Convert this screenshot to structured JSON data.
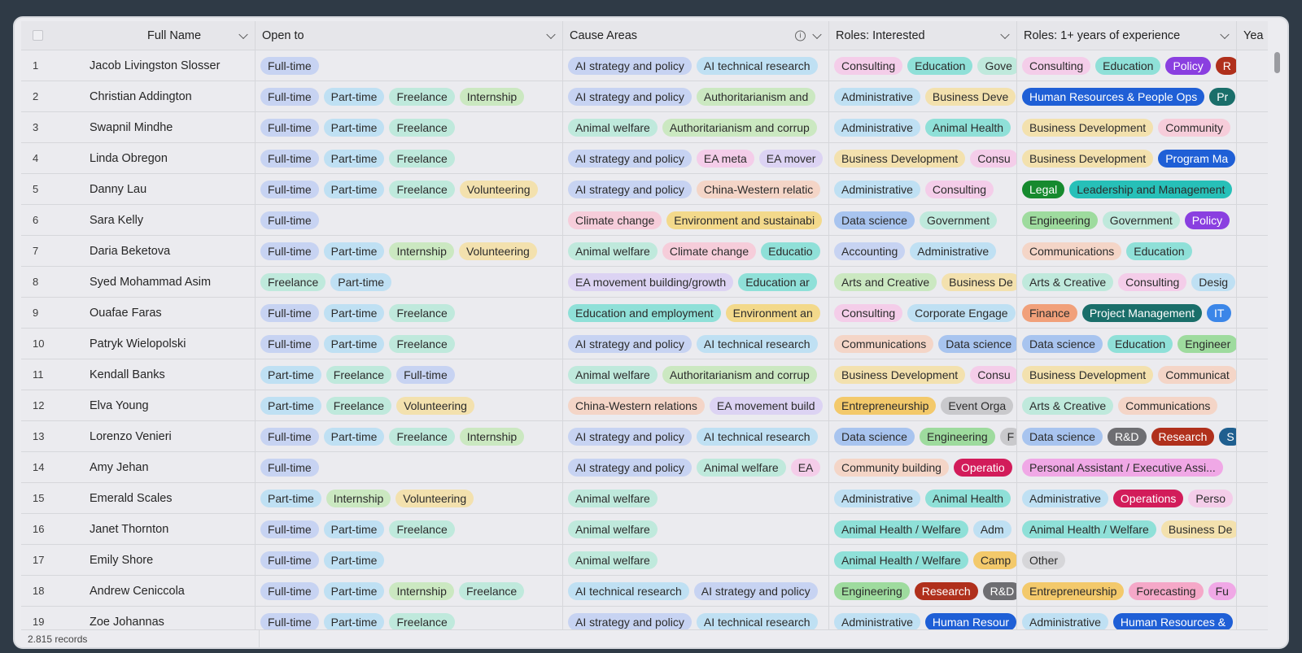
{
  "header": {
    "full_name": "Full Name",
    "open_to": "Open to",
    "cause_areas": "Cause Areas",
    "roles_interested": "Roles: Interested",
    "roles_experience": "Roles: 1+ years of experience",
    "year": "Yea"
  },
  "footer": {
    "records": "2.815 records"
  },
  "rows": [
    {
      "n": "1",
      "name": "Jacob Livingston Slosser",
      "open": [
        "Full-time"
      ],
      "cause": [
        "AI strategy and policy",
        "AI technical research"
      ],
      "ri": [
        "Consulting",
        "Education",
        "Gove"
      ],
      "rx": [
        "Consulting",
        "Education",
        "Policy",
        "R"
      ]
    },
    {
      "n": "2",
      "name": "Christian Addington",
      "open": [
        "Full-time",
        "Part-time",
        "Freelance",
        "Internship"
      ],
      "cause": [
        "AI strategy and policy",
        "Authoritarianism and"
      ],
      "ri": [
        "Administrative",
        "Business Deve"
      ],
      "rx": [
        "Human Resources & People Ops",
        "Pr"
      ]
    },
    {
      "n": "3",
      "name": "Swapnil Mindhe",
      "open": [
        "Full-time",
        "Part-time",
        "Freelance"
      ],
      "cause": [
        "Animal welfare",
        "Authoritarianism and corrup"
      ],
      "ri": [
        "Administrative",
        "Animal Health"
      ],
      "rx": [
        "Business Development",
        "Community"
      ]
    },
    {
      "n": "4",
      "name": "Linda Obregon",
      "open": [
        "Full-time",
        "Part-time",
        "Freelance"
      ],
      "cause": [
        "AI strategy and policy",
        "EA meta",
        "EA mover"
      ],
      "ri": [
        "Business Development",
        "Consu"
      ],
      "rx": [
        "Business Development",
        "Program Ma"
      ]
    },
    {
      "n": "5",
      "name": "Danny Lau",
      "open": [
        "Full-time",
        "Part-time",
        "Freelance",
        "Volunteering"
      ],
      "cause": [
        "AI strategy and policy",
        "China-Western relatic"
      ],
      "ri": [
        "Administrative",
        "Consulting"
      ],
      "rx": [
        "Legal",
        "Leadership and Management"
      ]
    },
    {
      "n": "6",
      "name": "Sara Kelly",
      "open": [
        "Full-time"
      ],
      "cause": [
        "Climate change",
        "Environment and sustainabi"
      ],
      "ri": [
        "Data science",
        "Government"
      ],
      "rx": [
        "Engineering",
        "Government",
        "Policy"
      ]
    },
    {
      "n": "7",
      "name": "Daria Beketova",
      "open": [
        "Full-time",
        "Part-time",
        "Internship",
        "Volunteering"
      ],
      "cause": [
        "Animal welfare",
        "Climate change",
        "Educatio"
      ],
      "ri": [
        "Accounting",
        "Administrative"
      ],
      "rx": [
        "Communications",
        "Education"
      ]
    },
    {
      "n": "8",
      "name": "Syed Mohammad Asim",
      "open": [
        "Freelance",
        "Part-time"
      ],
      "cause": [
        "EA movement building/growth",
        "Education ar"
      ],
      "ri": [
        "Arts and Creative",
        "Business De"
      ],
      "rx": [
        "Arts & Creative",
        "Consulting",
        "Desig"
      ]
    },
    {
      "n": "9",
      "name": "Ouafae Faras",
      "open": [
        "Full-time",
        "Part-time",
        "Freelance"
      ],
      "cause": [
        "Education and employment",
        "Environment an"
      ],
      "ri": [
        "Consulting",
        "Corporate Engage"
      ],
      "rx": [
        "Finance",
        "Project Management",
        "IT"
      ]
    },
    {
      "n": "10",
      "name": "Patryk Wielopolski",
      "open": [
        "Full-time",
        "Part-time",
        "Freelance"
      ],
      "cause": [
        "AI strategy and policy",
        "AI technical research"
      ],
      "ri": [
        "Communications",
        "Data science"
      ],
      "rx": [
        "Data science",
        "Education",
        "Engineer"
      ]
    },
    {
      "n": "11",
      "name": "Kendall Banks",
      "open": [
        "Part-time",
        "Freelance",
        "Full-time"
      ],
      "cause": [
        "Animal welfare",
        "Authoritarianism and corrup"
      ],
      "ri": [
        "Business Development",
        "Consu"
      ],
      "rx": [
        "Business Development",
        "Communicat"
      ]
    },
    {
      "n": "12",
      "name": "Elva Young",
      "open": [
        "Part-time",
        "Freelance",
        "Volunteering"
      ],
      "cause": [
        "China-Western relations",
        "EA movement build"
      ],
      "ri": [
        "Entrepreneurship",
        "Event Orga"
      ],
      "rx": [
        "Arts & Creative",
        "Communications"
      ]
    },
    {
      "n": "13",
      "name": "Lorenzo Venieri",
      "open": [
        "Full-time",
        "Part-time",
        "Freelance",
        "Internship"
      ],
      "cause": [
        "AI strategy and policy",
        "AI technical research"
      ],
      "ri": [
        "Data science",
        "Engineering",
        "F"
      ],
      "rx": [
        "Data science",
        "R&D",
        "Research",
        "S"
      ]
    },
    {
      "n": "14",
      "name": "Amy Jehan",
      "open": [
        "Full-time"
      ],
      "cause": [
        "AI strategy and policy",
        "Animal welfare",
        "EA"
      ],
      "ri": [
        "Community building",
        "Operatio"
      ],
      "rx": [
        "Personal Assistant / Executive Assi..."
      ]
    },
    {
      "n": "15",
      "name": "Emerald Scales",
      "open": [
        "Part-time",
        "Internship",
        "Volunteering"
      ],
      "cause": [
        "Animal welfare"
      ],
      "ri": [
        "Administrative",
        "Animal Health"
      ],
      "rx": [
        "Administrative",
        "Operations",
        "Perso"
      ]
    },
    {
      "n": "16",
      "name": "Janet Thornton",
      "open": [
        "Full-time",
        "Part-time",
        "Freelance"
      ],
      "cause": [
        "Animal welfare"
      ],
      "ri": [
        "Animal Health / Welfare",
        "Adm"
      ],
      "rx": [
        "Animal Health / Welfare",
        "Business De"
      ]
    },
    {
      "n": "17",
      "name": "Emily Shore",
      "open": [
        "Full-time",
        "Part-time"
      ],
      "cause": [
        "Animal welfare"
      ],
      "ri": [
        "Animal Health / Welfare",
        "Camp"
      ],
      "rx": [
        "Other"
      ]
    },
    {
      "n": "18",
      "name": "Andrew Ceniccola",
      "open": [
        "Full-time",
        "Part-time",
        "Internship",
        "Freelance"
      ],
      "cause": [
        "AI technical research",
        "AI strategy and policy"
      ],
      "ri": [
        "Engineering",
        "Research",
        "R&D"
      ],
      "rx": [
        "Entrepreneurship",
        "Forecasting",
        "Fu"
      ]
    },
    {
      "n": "19",
      "name": "Zoe Johannas",
      "open": [
        "Full-time",
        "Part-time",
        "Freelance"
      ],
      "cause": [
        "AI strategy and policy",
        "AI technical research"
      ],
      "ri": [
        "Administrative",
        "Human Resour"
      ],
      "rx": [
        "Administrative",
        "Human Resources &"
      ]
    }
  ],
  "colors": {
    "Full-time": "#c7d3f2",
    "Part-time": "#bfe0f3",
    "Freelance": "#bfe9dc",
    "Internship": "#cbe8c1",
    "Volunteering": "#f3e1ae",
    "AI strategy and policy": "#c7d3f2",
    "AI technical research": "#bfe0f3",
    "Authoritarianism and": "#cbe8c1",
    "Authoritarianism and corrup": "#cbe8c1",
    "Animal welfare": "#bfe9dc",
    "EA meta": "#f4cde9",
    "EA mover": "#dcd3f3",
    "China-Western relatic": "#f4d5c7",
    "China-Western relations": "#f4d5c7",
    "Climate change": "#f6cdda",
    "Environment and sustainabi": "#f3d98b",
    "Educatio": "#8fe0d8",
    "EA movement building/growth": "#dcd3f3",
    "Education ar": "#8fe0d8",
    "Education and employment": "#8fe0d8",
    "Environment an": "#f3d98b",
    "EA movement build": "#dcd3f3",
    "EA": "#f4cde9",
    "Consulting": "#f4cde9",
    "Education": "#8fe0d8",
    "Gove": "#bfe9dc",
    "Administrative": "#bfe0f3",
    "Business Deve": "#f3e1ae",
    "Animal Health": "#8fe0d8",
    "Business Development": "#f3e1ae",
    "Consu": "#f4cde9",
    "Data science": "#a8c4ef",
    "Government": "#bfe9dc",
    "Accounting": "#c7d3f2",
    "Arts and Creative": "#cbe8c1",
    "Business De": "#f3e1ae",
    "Corporate Engage": "#bfe0f3",
    "Communications": "#f4d5c7",
    "Entrepreneurship": "#f3c96b",
    "Event Orga": "#c9c9cc",
    "Engineering": "#9edb9e",
    "F": "#c9c9cc",
    "Community building": "#f4d5c7",
    "Operatio": "#d21c5a",
    "Animal Health / Welfare": "#8fe0d8",
    "Adm": "#bfe0f3",
    "Camp": "#f3c96b",
    "Research": "#b0301c",
    "R&D": "#6e6e72",
    "Human Resour": "#1f5fd6",
    "Policy": "#8a3fe0",
    "R": "#b0301c",
    "Human Resources & People Ops": "#1f5fd6",
    "Pr": "#1a6e6a",
    "Community": "#f6cdda",
    "Program Ma": "#1f5fd6",
    "Legal": "#168a2e",
    "Leadership and Management": "#27c0b8",
    "Arts & Creative": "#bfe9dc",
    "Desig": "#bfe0f3",
    "Finance": "#f1a07a",
    "Project Management": "#1a6e6a",
    "IT": "#3b86e8",
    "Engineer": "#9edb9e",
    "Communicat": "#f4d5c7",
    "S": "#1f5f8f",
    "Personal Assistant / Executive Assi...": "#f0a8e6",
    "Operations": "#d21c5a",
    "Perso": "#f4cde9",
    "Other": "#d6d6d9",
    "Forecasting": "#f5a8c8",
    "Fu": "#f0a8e6",
    "Human Resources &": "#1f5fd6"
  },
  "dark_pills": [
    "Operatio",
    "Research",
    "R&D",
    "Human Resour",
    "Policy",
    "R",
    "Human Resources & People Ops",
    "Pr",
    "Program Ma",
    "Legal",
    "Project Management",
    "IT",
    "S",
    "Operations",
    "Human Resources &"
  ],
  "icons": {
    "header_checkbox": "checkbox-icon",
    "chevron": "chevron-down-icon",
    "info": "info-icon"
  }
}
